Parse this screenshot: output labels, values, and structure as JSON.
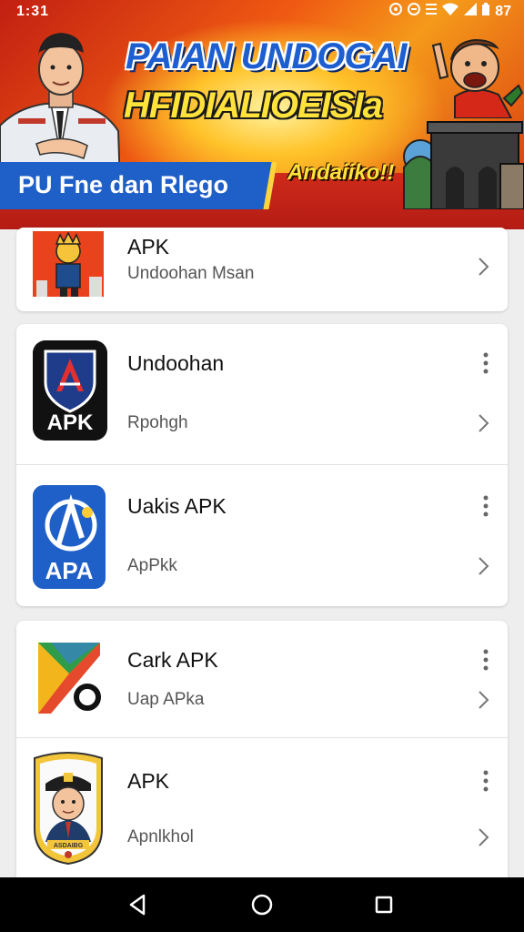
{
  "status_bar": {
    "time": "1:31",
    "battery": "87"
  },
  "banner": {
    "headline_line1": "PAIAN UNDOGAI",
    "headline_line2": "HFIDIALIOEISIa",
    "ribbon_text": "PU Fne dan Rlego",
    "tagline": "Andaiiko!!"
  },
  "list": [
    {
      "title": "APK",
      "subtitle": "Undoohan Msan",
      "icon": "indonesian-character-icon",
      "has_menu": false
    },
    {
      "title": "Undoohan",
      "subtitle": "Rpohgh",
      "icon": "shield-apk-icon",
      "has_menu": true
    },
    {
      "title": "Uakis APK",
      "subtitle": "ApPkk",
      "icon": "apa-icon",
      "has_menu": true
    },
    {
      "title": "Cark APK",
      "subtitle": "Uap APka",
      "icon": "play-store-icon",
      "has_menu": true
    },
    {
      "title": "APK",
      "subtitle": "Apnlkhol",
      "icon": "officer-badge-icon",
      "has_menu": true
    }
  ],
  "icon_labels": {
    "shield": "APK",
    "apa": "APA",
    "badge": "ASDAIBG"
  },
  "colors": {
    "banner_red": "#c21f12",
    "banner_orange": "#ef5a12",
    "headline_blue": "#1d5fd0",
    "headline_yellow": "#ffe23a",
    "card_bg": "#ffffff",
    "page_bg": "#eeeeef"
  }
}
